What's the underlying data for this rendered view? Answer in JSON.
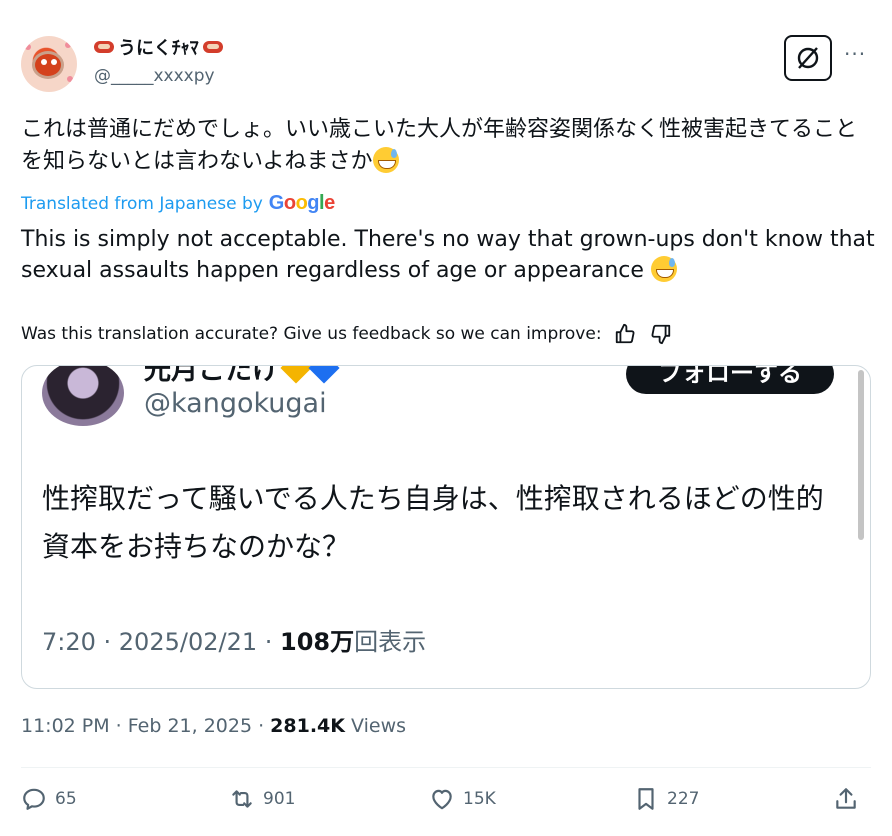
{
  "author": {
    "display_name": "うにくﾁｬﾏ",
    "handle": "@_____xxxxpy"
  },
  "post": {
    "text_jp": "これは普通にだめでしょ。いい歳こいた大人が年齢容姿関係なく性被害起きてることを知らないとは言わないよねまさか",
    "translated_from": "Translated from Japanese by",
    "google": [
      "G",
      "o",
      "o",
      "g",
      "l",
      "e"
    ],
    "text_en": "This is simply not acceptable. There's no way that grown-ups don't know that sexual assaults happen regardless of age or appearance",
    "feedback_prompt": "Was this translation accurate? Give us feedback so we can improve:",
    "timestamp": "11:02 PM · Feb 21, 2025 · ",
    "views_count": "281.4K",
    "views_label": " Views"
  },
  "quoted": {
    "display_name": "光月こたけ",
    "follow_label": "フォローする",
    "handle": "@kangokugai",
    "text": "性搾取だって騒いでる人たち自身は、性搾取されるほどの性的資本をお持ちなのかな？",
    "time": "7:20 · 2025/02/21 · ",
    "views_count": "108万",
    "views_label": "回表示"
  },
  "actions": {
    "replies": "65",
    "reposts": "901",
    "likes": "15K",
    "bookmarks": "227"
  },
  "icons": [
    "grok-icon",
    "more-icon",
    "thumbs-up-icon",
    "thumbs-down-icon",
    "reply-icon",
    "repost-icon",
    "like-icon",
    "bookmark-icon",
    "share-icon"
  ],
  "colors": {
    "link": "#1d9bf0",
    "text": "#0f1419",
    "muted": "#536471",
    "border": "#cfd9de"
  }
}
